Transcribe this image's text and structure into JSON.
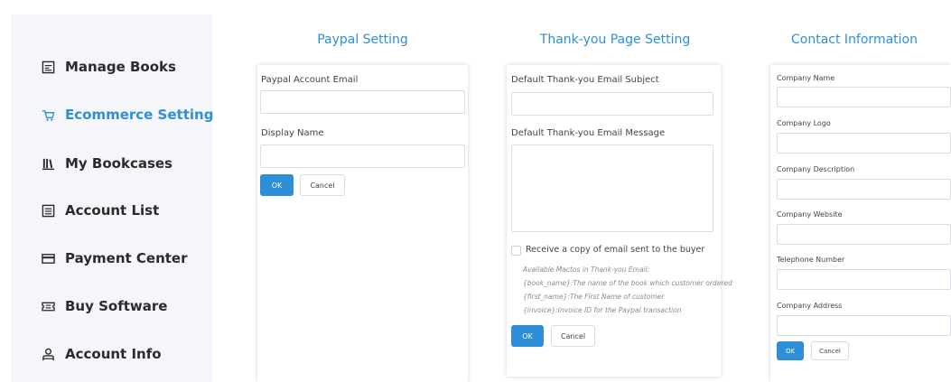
{
  "sidebar": {
    "items": [
      {
        "label": "Manage Books",
        "icon": "book-list-icon",
        "active": false
      },
      {
        "label": "Ecommerce Setting",
        "icon": "cart-icon",
        "active": true
      },
      {
        "label": "My Bookcases",
        "icon": "bookcase-icon",
        "active": false
      },
      {
        "label": "Account List",
        "icon": "list-icon",
        "active": false
      },
      {
        "label": "Payment Center",
        "icon": "card-icon",
        "active": false
      },
      {
        "label": "Buy Software",
        "icon": "ticket-icon",
        "active": false
      },
      {
        "label": "Account Info",
        "icon": "user-icon",
        "active": false
      }
    ]
  },
  "paypal": {
    "title": "Paypal Setting",
    "email_label": "Paypal Account Email",
    "email_value": "",
    "name_label": "Display Name",
    "name_value": "",
    "ok_label": "OK",
    "cancel_label": "Cancel"
  },
  "thankyou": {
    "title": "Thank-you Page Setting",
    "subject_label": "Default Thank-you Email Subject",
    "subject_value": "",
    "message_label": "Default Thank-you Email Message",
    "message_value": "",
    "copy_label": "Receive a copy of email sent to the buyer",
    "macros": [
      "Available Mactos in Thank-you Email:",
      "{book_name}:The name of the book which customer ordered",
      "{first_name}:The First Name of customer",
      "{invoice}:Invoice ID for the Paypal transaction"
    ],
    "ok_label": "OK",
    "cancel_label": "Cancel"
  },
  "contact": {
    "title": "Contact Information",
    "fields": [
      {
        "label": "Company Name",
        "value": ""
      },
      {
        "label": "Company Logo",
        "value": ""
      },
      {
        "label": "Company Description",
        "value": ""
      },
      {
        "label": "Company Website",
        "value": ""
      },
      {
        "label": "Telephone Number",
        "value": ""
      },
      {
        "label": "Company Address",
        "value": ""
      }
    ],
    "ok_label": "OK",
    "cancel_label": "Cancel"
  },
  "colors": {
    "accent": "#2e8fd8",
    "sidebar_bg": "#f4f6f9"
  }
}
